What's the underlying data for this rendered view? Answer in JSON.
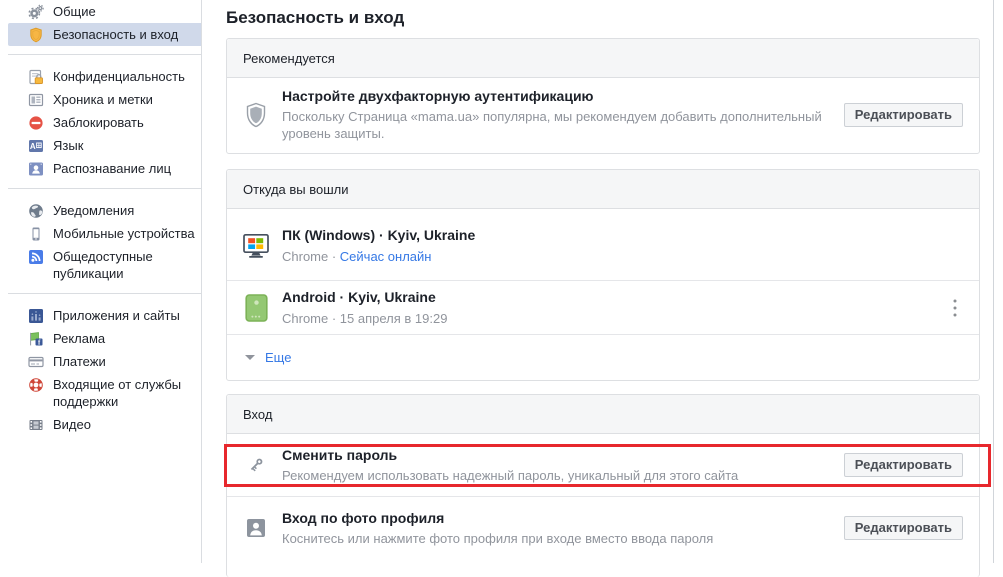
{
  "page_title": "Безопасность и вход",
  "colors": {
    "link": "#3578e5",
    "selected_item_bg": "#d0d9ea",
    "highlight_border": "#e7282d",
    "card_header_bg": "#f5f6f7",
    "secondary_text": "#90949c"
  },
  "sidebar": {
    "groups": [
      {
        "items": [
          {
            "icon": "gears-icon",
            "label": "Общие",
            "selected": false
          },
          {
            "icon": "shield-badge-icon",
            "label": "Безопасность и вход",
            "selected": true
          }
        ]
      },
      {
        "items": [
          {
            "icon": "privacy-lock-icon",
            "label": "Конфиденциальность",
            "selected": false
          },
          {
            "icon": "timeline-icon",
            "label": "Хроника и метки",
            "selected": false
          },
          {
            "icon": "block-icon",
            "label": "Заблокировать",
            "selected": false
          },
          {
            "icon": "language-icon",
            "label": "Язык",
            "selected": false
          },
          {
            "icon": "face-recognition-icon",
            "label": "Распознавание лиц",
            "selected": false
          }
        ]
      },
      {
        "items": [
          {
            "icon": "globe-icon",
            "label": "Уведомления",
            "selected": false
          },
          {
            "icon": "mobile-device-icon",
            "label": "Мобильные устройства",
            "selected": false
          },
          {
            "icon": "public-posts-icon",
            "label": "Общедоступные публикации",
            "selected": false
          }
        ]
      },
      {
        "items": [
          {
            "icon": "apps-icon",
            "label": "Приложения и сайты",
            "selected": false
          },
          {
            "icon": "ads-icon",
            "label": "Реклама",
            "selected": false
          },
          {
            "icon": "payments-icon",
            "label": "Платежи",
            "selected": false
          },
          {
            "icon": "support-lifering-icon",
            "label": "Входящие от службы поддержки",
            "selected": false
          },
          {
            "icon": "video-icon",
            "label": "Видео",
            "selected": false
          }
        ]
      }
    ]
  },
  "sections": {
    "recommended": {
      "header": "Рекомендуется",
      "twofactor": {
        "title": "Настройте двухфакторную аутентификацию",
        "description": "Поскольку Страница «mama.ua» популярна, мы рекомендуем добавить дополнительный уровень защиты.",
        "button": "Редактировать"
      }
    },
    "where_logged_in": {
      "header": "Откуда вы вошли",
      "windows": {
        "title": "ПК (Windows) · Kyiv, Ukraine",
        "meta_prefix": "Chrome · ",
        "status_link": "Сейчас онлайн"
      },
      "android": {
        "title": "Android · Kyiv, Ukraine",
        "meta": "Chrome · 15 апреля в 19:29"
      },
      "more_label": "Еще"
    },
    "login": {
      "header": "Вход",
      "change_password": {
        "title": "Сменить пароль",
        "description": "Рекомендуем использовать надежный пароль, уникальный для этого сайта",
        "button": "Редактировать"
      },
      "photo_login": {
        "title": "Вход по фото профиля",
        "description": "Коснитесь или нажмите фото профиля при входе вместо ввода пароля",
        "button": "Редактировать"
      }
    }
  }
}
